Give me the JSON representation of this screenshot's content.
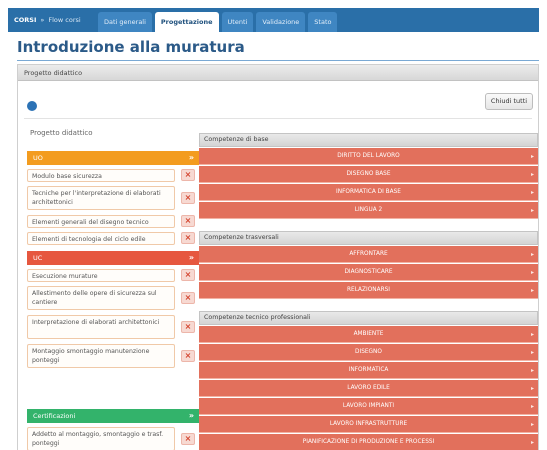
{
  "breadcrumb": {
    "home": "CORSI",
    "current": "Flow corsi"
  },
  "tabs": [
    {
      "label": "Dati generali",
      "active": false
    },
    {
      "label": "Progettazione",
      "active": true
    },
    {
      "label": "Utenti",
      "active": false
    },
    {
      "label": "Validazione",
      "active": false
    },
    {
      "label": "Stato",
      "active": false
    }
  ],
  "page_title": "Introduzione alla muratura",
  "panel": {
    "header": "Progetto didattico",
    "close_all_label": "Chiudi tutti",
    "info_icon": "info-icon"
  },
  "left": {
    "title": "Progetto didattico",
    "categories": [
      {
        "label": "UO",
        "color": "#f39c1f"
      },
      {
        "label": "UC",
        "color": "#e6573f"
      },
      {
        "label": "Certificazioni",
        "color": "#33b36b"
      }
    ],
    "modules_uo": [
      "Modulo base sicurezza",
      "Tecniche per l'interpretazione di elaborati architettonici",
      "Elementi generali del disegno tecnico",
      "Elementi di tecnologia del ciclo edile"
    ],
    "modules_uc": [
      "Esecuzione murature",
      "Allestimento delle opere di sicurezza sul cantiere",
      "Interpretazione di elaborati architettonici",
      "Montaggio smontaggio manutenzione ponteggi"
    ],
    "modules_cert": [
      "Addetto al montaggio, smontaggio e trasf. ponteggi"
    ]
  },
  "right": {
    "groups": [
      {
        "title": "Competenze di base",
        "items": [
          "Diritto del lavoro",
          "Disegno base",
          "Informatica di base",
          "Lingua 2"
        ]
      },
      {
        "title": "Competenze trasversali",
        "items": [
          "Affrontare",
          "Diagnosticare",
          "Relazionarsi"
        ]
      },
      {
        "title": "Competenze tecnico professionali",
        "items": [
          "Ambiente",
          "Disegno",
          "Informatica",
          "Lavoro edile",
          "Lavoro impianti",
          "Lavoro infrastrutture",
          "Pianificazione di produzione e processi"
        ]
      }
    ]
  },
  "colors": {
    "nav_bar": "#2a6fa8",
    "title": "#2b5a88",
    "competence": "#e2705c"
  }
}
